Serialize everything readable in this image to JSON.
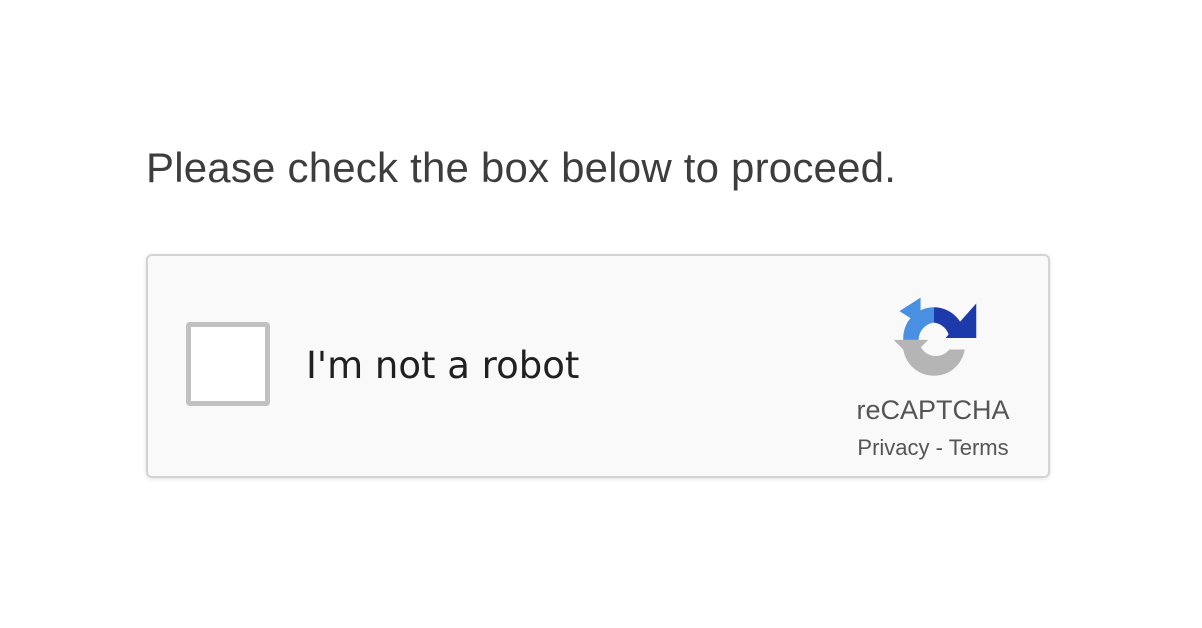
{
  "page": {
    "instruction": "Please check the box below to proceed."
  },
  "captcha": {
    "checkbox_label": "I'm not a robot",
    "checked": false,
    "brand_name": "reCAPTCHA",
    "privacy_link": "Privacy",
    "separator": "-",
    "terms_link": "Terms",
    "logo_icon": "recaptcha-logo-icon",
    "colors": {
      "logo_blue_dark": "#1c3aa9",
      "logo_blue_light": "#4a90e2",
      "logo_gray": "#b5b5b5",
      "widget_background": "#f9f9f9",
      "widget_border": "#d3d3d3"
    }
  }
}
